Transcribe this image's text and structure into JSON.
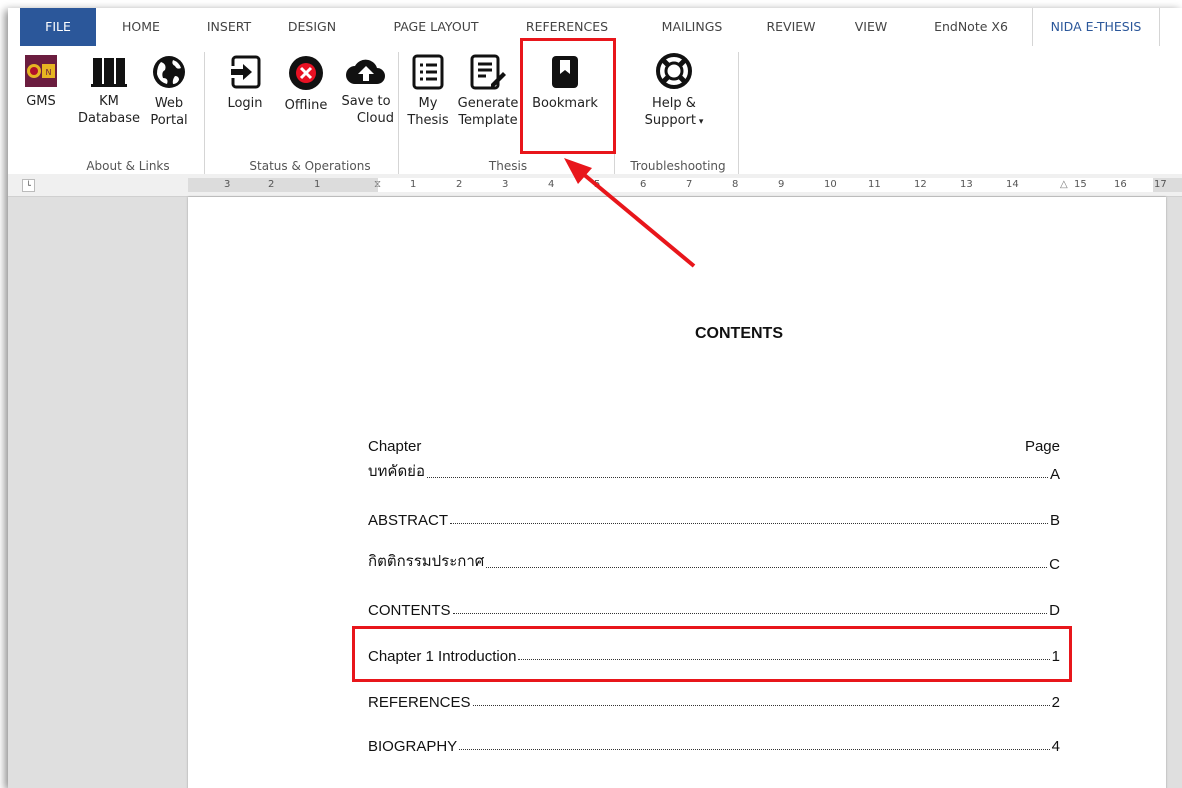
{
  "menu": {
    "tabs": [
      "FILE",
      "HOME",
      "INSERT",
      "DESIGN",
      "PAGE LAYOUT",
      "REFERENCES",
      "MAILINGS",
      "REVIEW",
      "VIEW",
      "EndNote X6",
      "NIDA E-THESIS"
    ]
  },
  "ribbon": {
    "groups": {
      "about": {
        "label": "About & Links",
        "buttons": [
          {
            "line1": "GMS",
            "line2": "",
            "icon": "nida-logo-icon"
          },
          {
            "line1": "KM",
            "line2": "Database",
            "icon": "book-icon"
          },
          {
            "line1": "Web",
            "line2": "Portal",
            "icon": "globe-icon"
          }
        ]
      },
      "status": {
        "label": "Status & Operations",
        "buttons": [
          {
            "line1": "Login",
            "line2": "",
            "icon": "login-icon"
          },
          {
            "line1": "Offline",
            "line2": "",
            "icon": "offline-icon"
          },
          {
            "line1": "Save to",
            "line2": "Cloud",
            "icon": "cloud-upload-icon"
          }
        ]
      },
      "thesis": {
        "label": "Thesis",
        "buttons": [
          {
            "line1": "My",
            "line2": "Thesis",
            "icon": "list-icon"
          },
          {
            "line1": "Generate",
            "line2": "Template",
            "icon": "template-icon"
          },
          {
            "line1": "Bookmark",
            "line2": "",
            "icon": "bookmark-icon"
          }
        ]
      },
      "trouble": {
        "label": "Troubleshooting",
        "buttons": [
          {
            "line1": "Help &",
            "line2": "Support",
            "icon": "lifebuoy-icon"
          }
        ]
      }
    }
  },
  "ruler": {
    "labels": [
      "3",
      "2",
      "1",
      "1",
      "2",
      "3",
      "4",
      "5",
      "6",
      "7",
      "8",
      "9",
      "10",
      "11",
      "12",
      "13",
      "14",
      "15",
      "16",
      "17"
    ]
  },
  "document": {
    "heading": "CONTENTS",
    "col_left": "Chapter",
    "col_right": "Page",
    "entries": [
      {
        "label": "บทคัดย่อ",
        "page": "A"
      },
      {
        "label": "ABSTRACT",
        "page": "B"
      },
      {
        "label": "กิตติกรรมประกาศ",
        "page": "C"
      },
      {
        "label": "CONTENTS",
        "page": "D"
      },
      {
        "label": "Chapter 1 Introduction",
        "page": "1"
      },
      {
        "label": "REFERENCES",
        "page": "2"
      },
      {
        "label": "BIOGRAPHY",
        "page": "4"
      }
    ]
  },
  "colors": {
    "file_tab": "#2b579a",
    "active_tab_text": "#2b579a",
    "highlight": "#e8161b"
  }
}
